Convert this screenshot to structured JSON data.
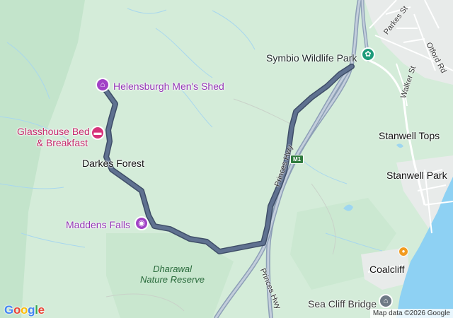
{
  "map": {
    "pois": {
      "helensburgh_mens_shed": "Helensburgh Men's Shed",
      "glasshouse_bed_line1": "Glasshouse Bed",
      "glasshouse_bed_line2": "& Breakfast",
      "maddens_falls": "Maddens Falls",
      "symbio_wildlife_park": "Symbio Wildlife Park",
      "sea_cliff_bridge": "Sea Cliff Bridge"
    },
    "places": {
      "darkes_forest": "Darkes Forest",
      "stanwell_tops": "Stanwell Tops",
      "stanwell_park": "Stanwell Park",
      "coalcliff": "Coalcliff"
    },
    "parks": {
      "dharawal_line1": "Dharawal",
      "dharawal_line2": "Nature Reserve"
    },
    "streets": {
      "parkes_st": "Parkes St",
      "otford_rd": "Otford Rd",
      "walker_st": "Walker St"
    },
    "highways": {
      "princes_hwy_upper": "Princes Hwy",
      "princes_hwy_lower": "Princes Hwy",
      "shield": "M1"
    },
    "logo": {
      "letters": [
        "G",
        "o",
        "o",
        "g",
        "l",
        "e"
      ],
      "colors": [
        "#4285F4",
        "#EA4335",
        "#FBBC05",
        "#4285F4",
        "#34A853",
        "#EA4335"
      ]
    },
    "attribution": "Map data ©2026 Google",
    "colors": {
      "land": "#d4ecd9",
      "forest": "#c3e4cb",
      "water": "#8ed1f3",
      "urban": "#e9ecec",
      "route": "#5a6b85",
      "route_outline": "#3f4e68",
      "highway": "#a9b6c7"
    },
    "icons": {
      "helensburgh_mens_shed": "landmark-icon",
      "glasshouse_bed": "bed-icon",
      "maddens_falls": "camera-icon",
      "symbio_wildlife_park": "paw-icon",
      "sea_cliff_bridge": "landmark-icon",
      "coalcliff": "food-icon"
    }
  }
}
